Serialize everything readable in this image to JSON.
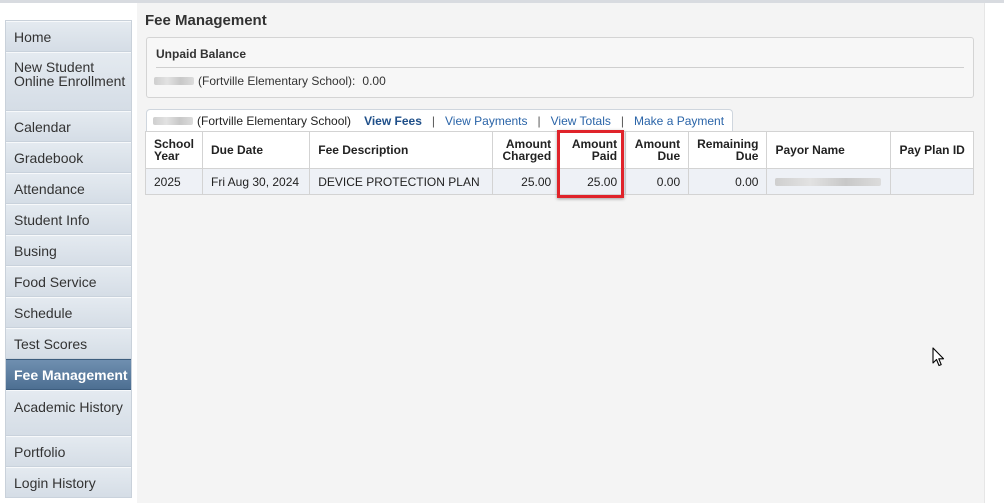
{
  "sidebar": {
    "items": [
      {
        "label": "Home"
      },
      {
        "label": "New Student Online Enrollment"
      },
      {
        "label": "Calendar"
      },
      {
        "label": "Gradebook"
      },
      {
        "label": "Attendance"
      },
      {
        "label": "Student Info"
      },
      {
        "label": "Busing"
      },
      {
        "label": "Food Service"
      },
      {
        "label": "Schedule"
      },
      {
        "label": "Test Scores"
      },
      {
        "label": "Fee Management"
      },
      {
        "label": "Academic History"
      },
      {
        "label": "Portfolio"
      },
      {
        "label": "Login History"
      }
    ],
    "active_index": 10
  },
  "page": {
    "title": "Fee Management"
  },
  "balance": {
    "title": "Unpaid Balance",
    "school": "(Fortville Elementary School):",
    "amount": "0.00"
  },
  "tab": {
    "school": "(Fortville Elementary School)",
    "links": [
      "View Fees",
      "View Payments",
      "View Totals",
      "Make a Payment"
    ],
    "separator": "|"
  },
  "table": {
    "headers": {
      "school_year": "School Year",
      "due_date": "Due Date",
      "fee_description": "Fee Description",
      "amount_charged": "Amount Charged",
      "amount_paid": "Amount Paid",
      "amount_due": "Amount Due",
      "remaining_due": "Remaining Due",
      "payor_name": "Payor Name",
      "pay_plan_id": "Pay Plan ID"
    },
    "rows": [
      {
        "school_year": "2025",
        "due_date": "Fri Aug 30, 2024",
        "fee_description": "DEVICE PROTECTION PLAN",
        "amount_charged": "25.00",
        "amount_paid": "25.00",
        "amount_due": "0.00",
        "remaining_due": "0.00",
        "pay_plan_id": ""
      }
    ]
  },
  "colors": {
    "accent_link": "#2a64a8",
    "active_nav": "#5a7ca0",
    "highlight": "#e0232a"
  }
}
